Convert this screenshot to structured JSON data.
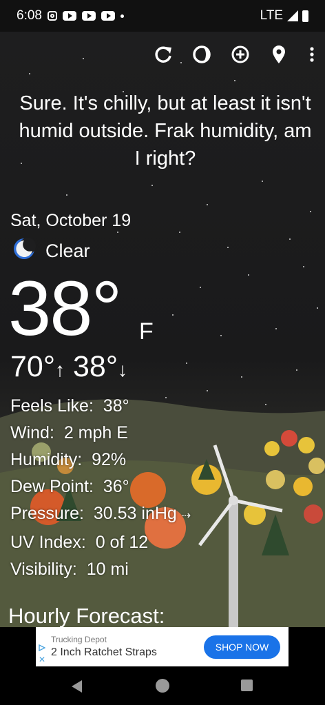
{
  "status_bar": {
    "time": "6:08",
    "network": "LTE"
  },
  "toolbar": {
    "icons": [
      "refresh-icon",
      "theme-icon",
      "add-location-icon",
      "location-pin-icon",
      "more-vert-icon"
    ]
  },
  "quote": "Sure. It's chilly, but at least it isn't humid outside. Frak humidity, am I right?",
  "weather": {
    "date": "Sat, October 19",
    "condition": "Clear",
    "condition_icon": "moon-icon",
    "temperature": "38°",
    "unit": "F",
    "high": "70°",
    "low": "38°"
  },
  "details": {
    "feels_like": {
      "label": "Feels Like:",
      "value": "38°"
    },
    "wind": {
      "label": "Wind:",
      "value": "2 mph E"
    },
    "humidity": {
      "label": "Humidity:",
      "value": "92%"
    },
    "dew_point": {
      "label": "Dew Point:",
      "value": "36°"
    },
    "pressure": {
      "label": "Pressure:",
      "value": "30.53 inHg"
    },
    "uv_index": {
      "label": "UV Index:",
      "value": "0 of 12"
    },
    "visibility": {
      "label": "Visibility:",
      "value": "10 mi"
    }
  },
  "hourly_forecast_title": "Hourly Forecast:",
  "ad": {
    "advertiser": "Trucking Depot",
    "title": "2 Inch Ratchet Straps",
    "cta": "SHOP NOW",
    "cta_color": "#1a73e8"
  }
}
